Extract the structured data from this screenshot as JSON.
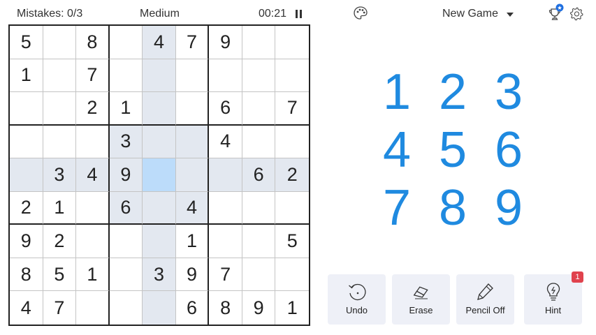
{
  "header": {
    "mistakes": "Mistakes: 0/3",
    "difficulty": "Medium",
    "timer": "00:21",
    "new_game_label": "New Game"
  },
  "icons": {
    "pause": "pause-icon",
    "palette": "palette-icon",
    "trophy": "trophy-icon",
    "settings": "gear-icon",
    "undo": "undo-icon",
    "erase": "eraser-icon",
    "pencil": "pencil-icon",
    "hint": "lightbulb-icon"
  },
  "board": {
    "rows": [
      [
        "5",
        "",
        "8",
        "",
        "4",
        "7",
        "9",
        "",
        ""
      ],
      [
        "1",
        "",
        "7",
        "",
        "",
        "",
        "",
        "",
        ""
      ],
      [
        "",
        "",
        "2",
        "1",
        "",
        "",
        "6",
        "",
        "7"
      ],
      [
        "",
        "",
        "",
        "3",
        "",
        "",
        "4",
        "",
        ""
      ],
      [
        "",
        "3",
        "4",
        "9",
        "",
        "",
        "",
        "6",
        "2"
      ],
      [
        "2",
        "1",
        "",
        "6",
        "",
        "4",
        "",
        "",
        ""
      ],
      [
        "9",
        "2",
        "",
        "",
        "",
        "1",
        "",
        "",
        "5"
      ],
      [
        "8",
        "5",
        "1",
        "",
        "3",
        "9",
        "7",
        "",
        ""
      ],
      [
        "4",
        "7",
        "",
        "",
        "",
        "6",
        "8",
        "9",
        "1"
      ]
    ],
    "selected": {
      "row": 5,
      "col": 5
    }
  },
  "numpad": [
    "1",
    "2",
    "3",
    "4",
    "5",
    "6",
    "7",
    "8",
    "9"
  ],
  "actions": [
    {
      "label": "Undo",
      "icon": "undo-icon"
    },
    {
      "label": "Erase",
      "icon": "eraser-icon"
    },
    {
      "label": "Pencil Off",
      "icon": "pencil-icon"
    },
    {
      "label": "Hint",
      "icon": "lightbulb-icon",
      "badge": "1"
    }
  ],
  "colors": {
    "number_blue": "#1f8ae0",
    "highlight": "#e3e8f0",
    "selected": "#bcdcfa",
    "action_bg": "#eef0f7",
    "badge_red": "#e0424d"
  }
}
